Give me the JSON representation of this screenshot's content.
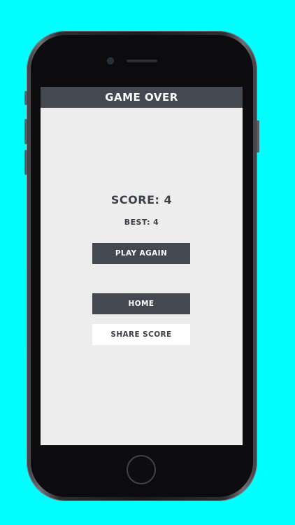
{
  "theme": {
    "background_color": "#00ffff",
    "dark_color": "#444850",
    "screen_color": "#ededed"
  },
  "screen": {
    "title": "GAME OVER",
    "score_text": "SCORE: 4",
    "best_text": "BEST: 4"
  },
  "buttons": {
    "play_again": "PLAY AGAIN",
    "home": "HOME",
    "share_score": "SHARE SCORE"
  }
}
